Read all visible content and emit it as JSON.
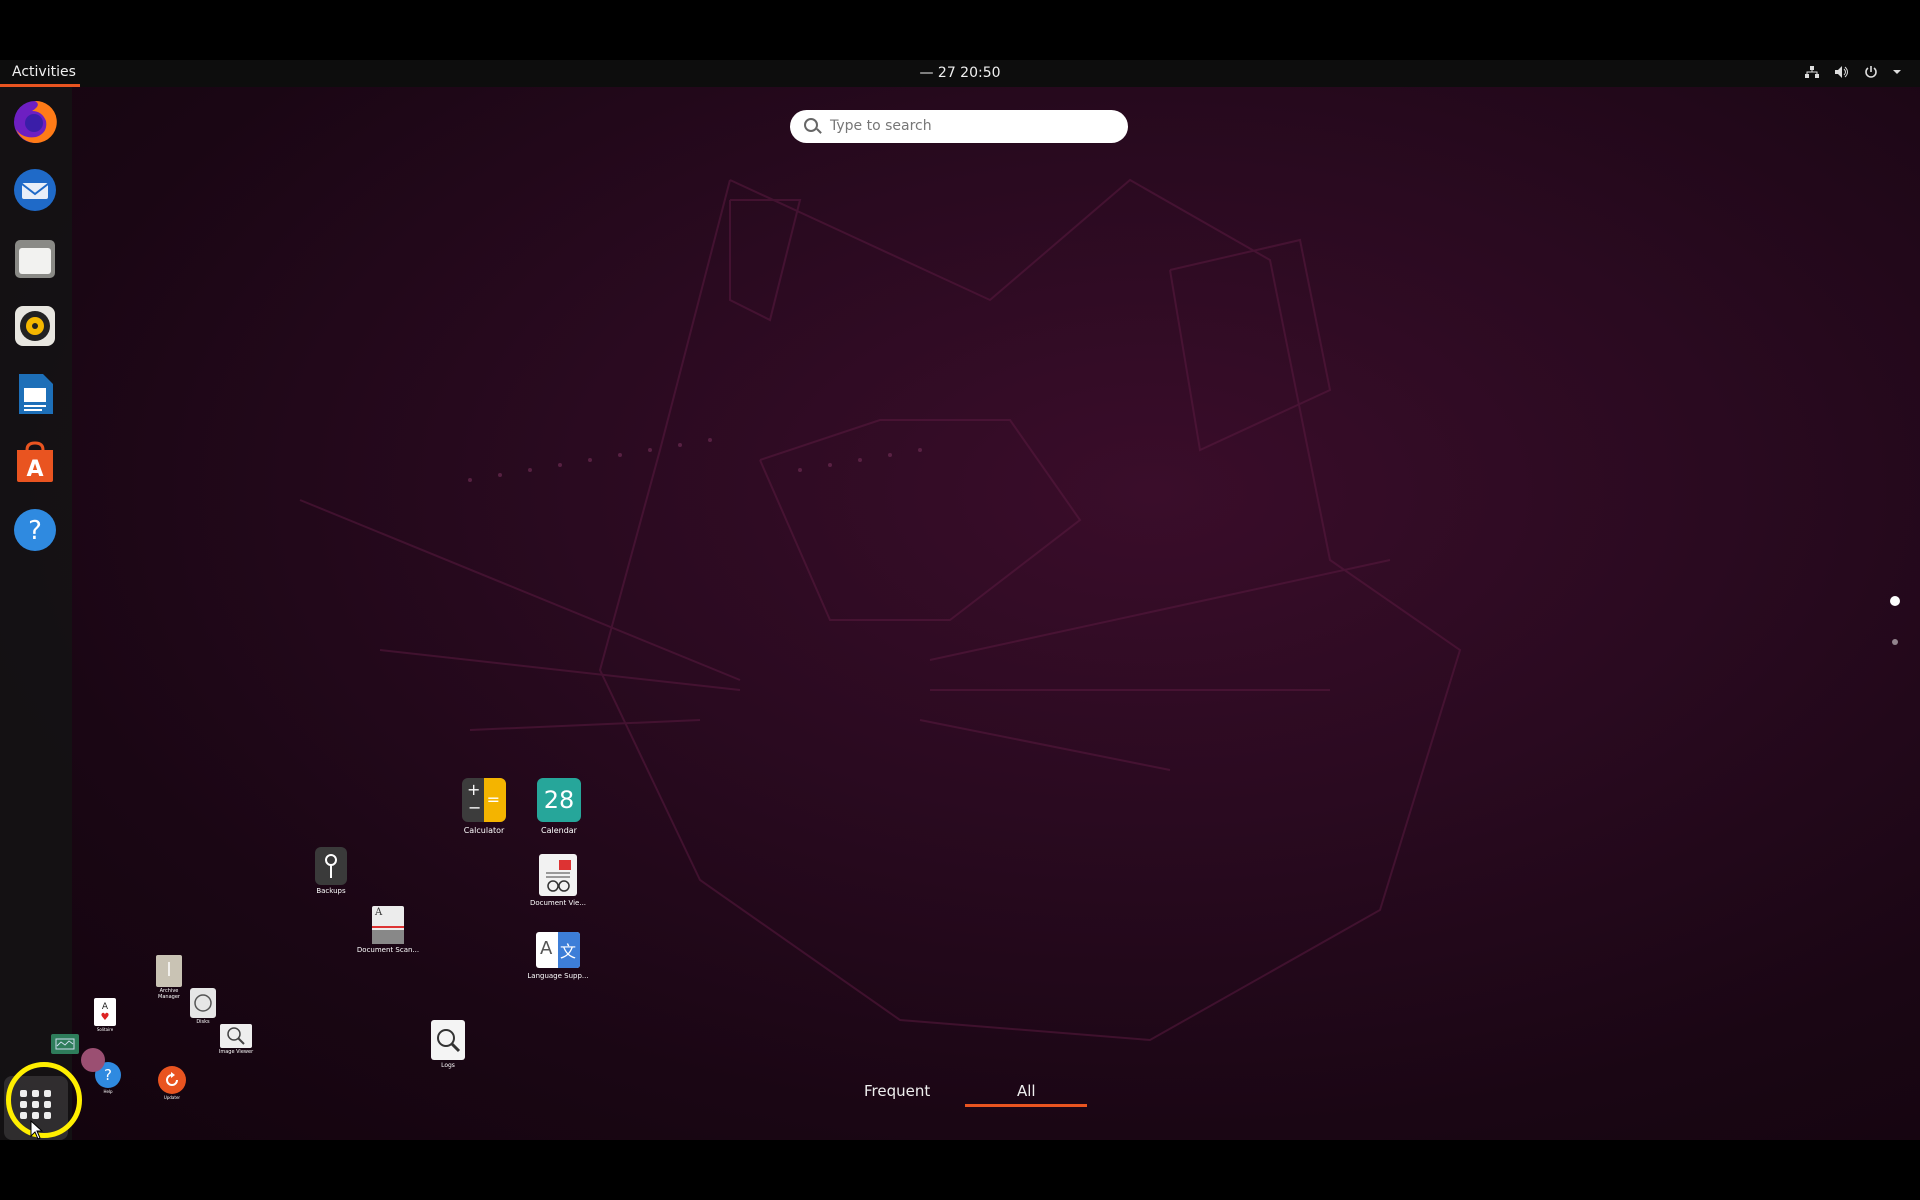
{
  "topbar": {
    "activities": "Activities",
    "clock": "— 27  20:50",
    "tray_icons": [
      "network-icon",
      "volume-icon",
      "power-icon",
      "chevron-down-icon"
    ]
  },
  "search": {
    "placeholder": "Type to search"
  },
  "dock": {
    "apps": [
      "Firefox",
      "Thunderbird",
      "Files",
      "Rhythmbox",
      "LibreOffice Writer",
      "Ubuntu Software",
      "Help"
    ]
  },
  "apps": {
    "calculator": "Calculator",
    "calendar": "Calendar",
    "calendar_day": "28",
    "backups": "Backups",
    "document_viewer": "Document Vie...",
    "document_scanner": "Document Scan...",
    "language_support": "Language Supp...",
    "logs": "Logs",
    "image_viewer": "Image Viewer",
    "disks": "Disks",
    "archive_manager": "Archive Manager",
    "solitaire": "Solitaire",
    "updater": "Updater",
    "help": "Help",
    "settings": "Settings",
    "system_monitor": "System Monitor"
  },
  "tabs": {
    "frequent": "Frequent",
    "all": "All"
  },
  "colors": {
    "accent": "#e95420",
    "highlight": "#ffef00"
  }
}
